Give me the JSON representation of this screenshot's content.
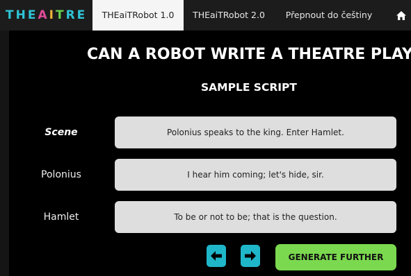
{
  "logo": {
    "letters": [
      "T",
      "H",
      "E",
      "A",
      "I",
      "T",
      "R",
      "E"
    ],
    "colors": [
      "#2fc4d6",
      "#2fc4d6",
      "#2fc4d6",
      "#e04b97",
      "#f0b33a",
      "#6ad14d",
      "#2fc4d6",
      "#2fc4d6"
    ]
  },
  "nav": {
    "tabs": [
      {
        "label": "THEaiTRobot 1.0"
      },
      {
        "label": "THEaiTRobot 2.0"
      },
      {
        "label": "Přepnout do češtiny"
      }
    ],
    "home_icon": "home-icon"
  },
  "main": {
    "title": "CAN A ROBOT WRITE A THEATRE PLAY?",
    "subtitle": "SAMPLE SCRIPT",
    "script": [
      {
        "speaker": "Scene",
        "text": "Polonius speaks to the king. Enter Hamlet."
      },
      {
        "speaker": "Polonius",
        "text": "I hear him coming; let's hide, sir."
      },
      {
        "speaker": "Hamlet",
        "text": "To be or not to be; that is the question."
      }
    ],
    "buttons": {
      "prev_icon": "arrow-left-icon",
      "next_icon": "arrow-right-icon",
      "generate_label": "GENERATE FURTHER"
    }
  },
  "colors": {
    "accent_cyan": "#1fb6c9",
    "generate_green": "#7bd94f",
    "active_tab_bg": "#f5f5f5"
  }
}
